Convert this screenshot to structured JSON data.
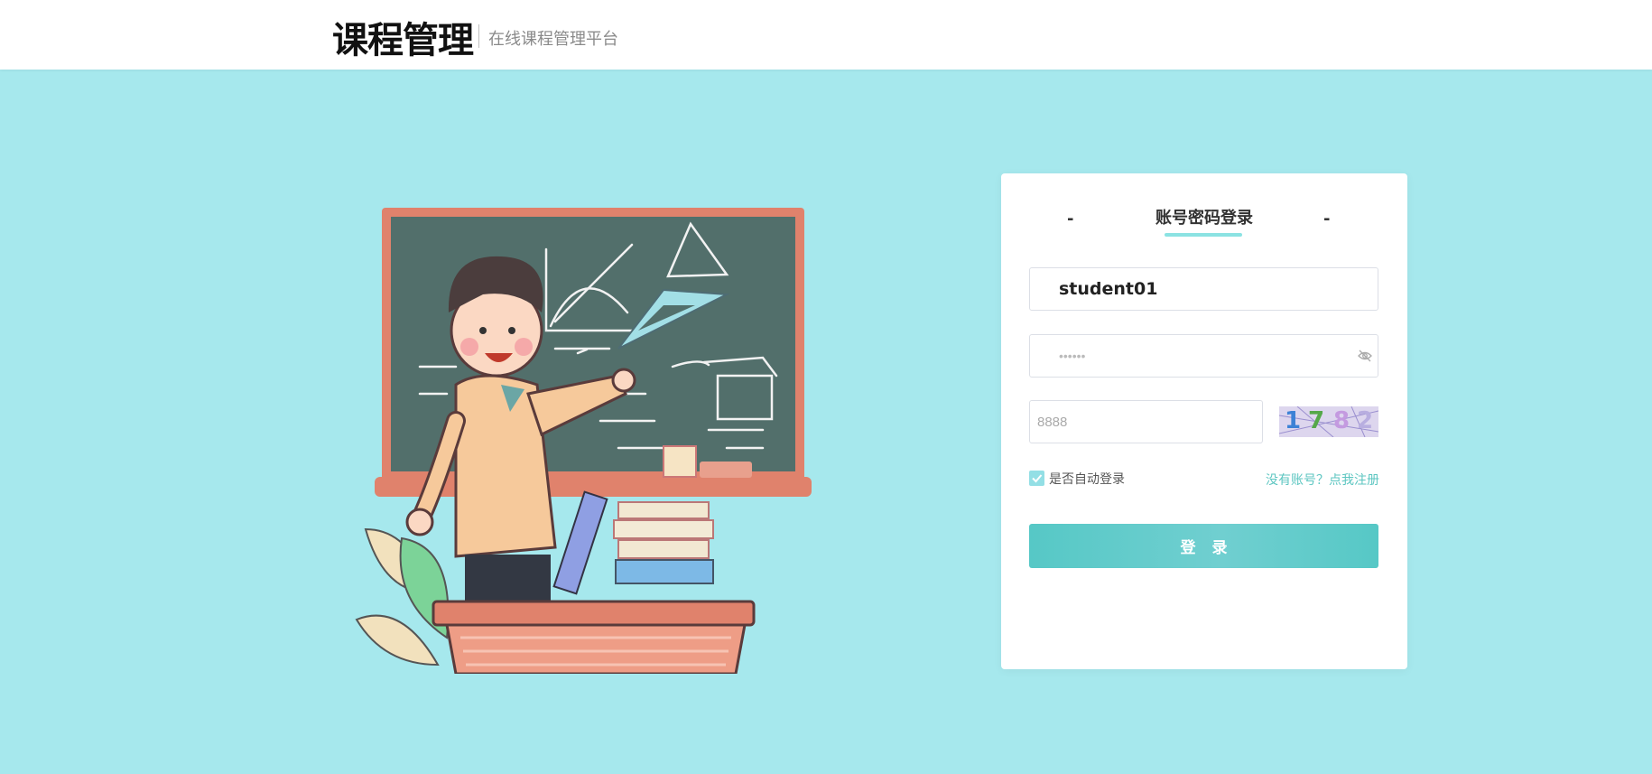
{
  "header": {
    "logo_text": "课程管理",
    "subtitle": "在线课程管理平台"
  },
  "login": {
    "tab_dash_left": "-",
    "tab_title": "账号密码登录",
    "tab_dash_right": "-",
    "username_value": "student01",
    "password_value": "••••••",
    "captcha_placeholder": "8888",
    "captcha_digits": [
      "1",
      "7",
      "8",
      "2"
    ],
    "remember_label": "是否自动登录",
    "register_link": "没有账号？点我注册",
    "submit_label": "登录"
  },
  "colors": {
    "background": "#a6e8ed",
    "accent": "#56c8c6",
    "link": "#5cc6c1"
  },
  "icons": [
    "eye-hide-icon",
    "check-icon"
  ]
}
